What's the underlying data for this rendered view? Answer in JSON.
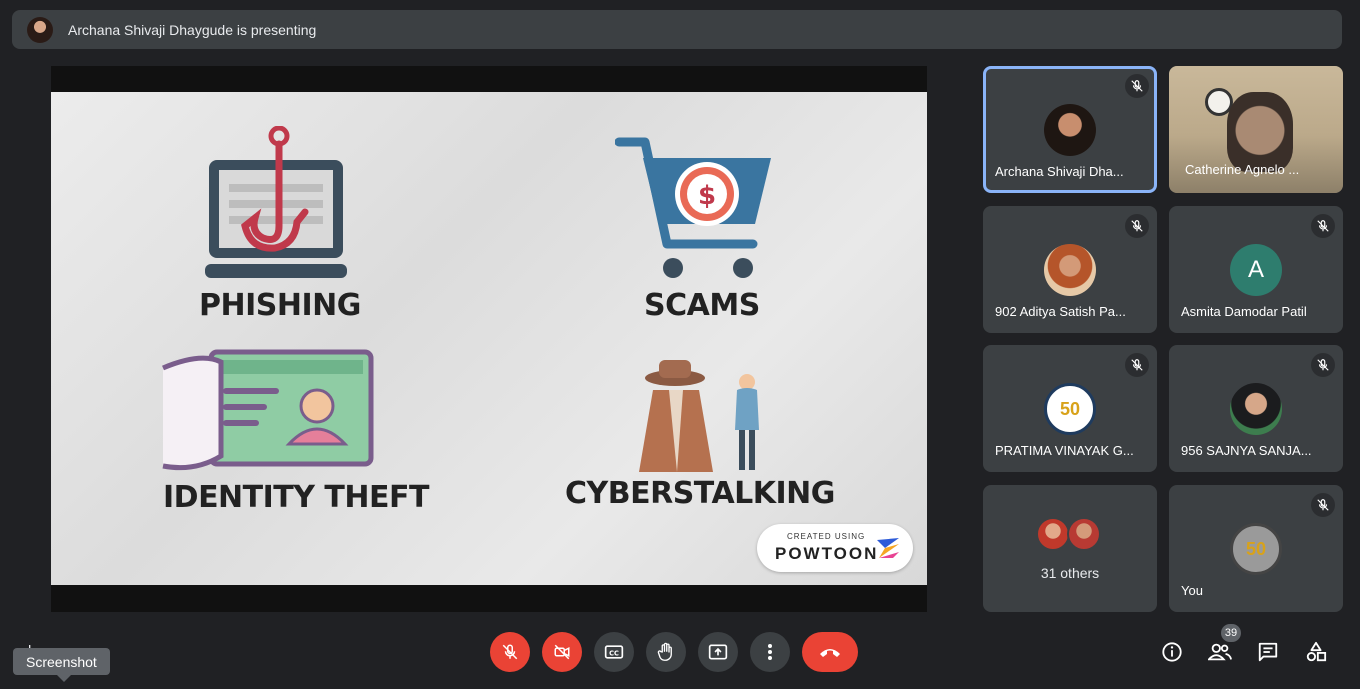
{
  "banner": {
    "presenting_text": "Archana Shivaji Dhaygude is presenting"
  },
  "slide": {
    "labels": {
      "phishing": "PHISHING",
      "scams": "SCAMS",
      "identity_theft": "IDENTITY THEFT",
      "cyberstalking": "CYBERSTALKING"
    },
    "watermark": {
      "small": "CREATED USING",
      "brand": "POWTOON"
    }
  },
  "participants": [
    {
      "name": "Archana Shivaji Dha...",
      "muted": true,
      "active": true
    },
    {
      "name": "Catherine Agnelo ...",
      "muted": false,
      "video": true
    },
    {
      "name": "902 Aditya Satish Pa...",
      "muted": true
    },
    {
      "name": "Asmita Damodar Patil",
      "muted": true,
      "initial": "A",
      "avatar_color": "#2e7d6e"
    },
    {
      "name": "PRATIMA VINAYAK G...",
      "muted": true
    },
    {
      "name": "956 SAJNYA SANJA...",
      "muted": true
    },
    {
      "others_label": "31 others"
    },
    {
      "name": "You",
      "muted": true
    }
  ],
  "bottom": {
    "meeting_name": "l    wa",
    "tooltip": "Screenshot",
    "participant_count": "39"
  },
  "colors": {
    "background": "#202124",
    "tile": "#3c4043",
    "red": "#ea4335",
    "active_border": "#8ab4f8"
  }
}
